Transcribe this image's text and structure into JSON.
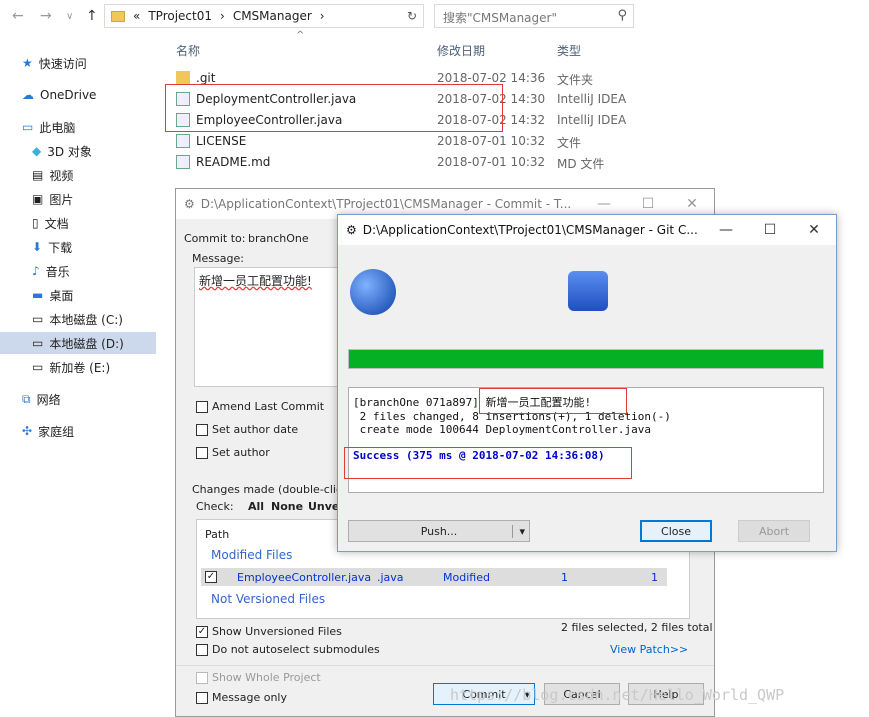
{
  "explorer": {
    "breadcrumb": [
      "«",
      "TProject01",
      "›",
      "CMSManager",
      "›"
    ],
    "search_placeholder": "搜索\"CMSManager\"",
    "columns": [
      "名称",
      "修改日期",
      "类型"
    ],
    "nav": [
      {
        "label": "快速访问",
        "icon": "star-icon"
      },
      {
        "label": "OneDrive",
        "icon": "cloud-icon"
      },
      {
        "label": "此电脑",
        "icon": "computer-icon"
      },
      {
        "label": "3D 对象",
        "icon": "cube-icon"
      },
      {
        "label": "视频",
        "icon": "video-icon"
      },
      {
        "label": "图片",
        "icon": "picture-icon"
      },
      {
        "label": "文档",
        "icon": "document-icon"
      },
      {
        "label": "下载",
        "icon": "download-icon"
      },
      {
        "label": "音乐",
        "icon": "music-icon"
      },
      {
        "label": "桌面",
        "icon": "desktop-icon"
      },
      {
        "label": "本地磁盘 (C:)",
        "icon": "drive-icon"
      },
      {
        "label": "本地磁盘 (D:)",
        "icon": "drive-icon"
      },
      {
        "label": "新加卷 (E:)",
        "icon": "drive-icon"
      },
      {
        "label": "网络",
        "icon": "network-icon"
      },
      {
        "label": "家庭组",
        "icon": "homegroup-icon"
      }
    ],
    "files": [
      {
        "name": ".git",
        "date": "2018-07-02 14:36",
        "type": "文件夹",
        "icon": "folder-icon"
      },
      {
        "name": "DeploymentController.java",
        "date": "2018-07-02 14:30",
        "type": "IntelliJ IDEA",
        "icon": "git-file-icon"
      },
      {
        "name": "EmployeeController.java",
        "date": "2018-07-02 14:32",
        "type": "IntelliJ IDEA",
        "icon": "git-file-icon"
      },
      {
        "name": "LICENSE",
        "date": "2018-07-01 10:32",
        "type": "文件",
        "icon": "git-file-icon"
      },
      {
        "name": "README.md",
        "date": "2018-07-01 10:32",
        "type": "MD 文件",
        "icon": "git-file-icon"
      }
    ]
  },
  "commit": {
    "title": "D:\\ApplicationContext\\TProject01\\CMSManager - Commit - T...",
    "commit_to_label": "Commit to:",
    "branch": "branchOne",
    "message_label": "Message:",
    "message": "新增一员工配置功能!",
    "amend": "Amend Last Commit",
    "set_author_date": "Set author date",
    "set_author": "Set author",
    "changes_label": "Changes made (double-click on",
    "check_label": "Check:",
    "check_all": "All",
    "check_none": "None",
    "check_unv": "Unve",
    "path_header": "Path",
    "modified_group": "Modified Files",
    "file_row": {
      "name": "EmployeeController.java",
      "ext": ".java",
      "status": "Modified",
      "added": "1",
      "removed": "1"
    },
    "not_versioned_group": "Not Versioned Files",
    "show_unversioned": "Show Unversioned Files",
    "no_autoselect": "Do not autoselect submodules",
    "files_selected": "2 files selected, 2 files total",
    "view_patch": "View Patch>>",
    "show_whole": "Show Whole Project",
    "message_only": "Message only",
    "commit_btn": "Commit",
    "cancel_btn": "Cancel",
    "help_btn": "Help"
  },
  "git": {
    "title": "D:\\ApplicationContext\\TProject01\\CMSManager - Git C...",
    "progress": 1.0,
    "log": [
      "[branchOne 071a897] 新增一员工配置功能!",
      " 2 files changed, 8 insertions(+), 1 deletion(-)",
      " create mode 100644 DeploymentController.java"
    ],
    "success": "Success (375 ms @ 2018-07-02 14:36:08)",
    "push_btn": "Push...",
    "close_btn": "Close",
    "abort_btn": "Abort"
  },
  "watermark": "https://blog.csdn.net/Hello_World_QWP",
  "colors": {
    "progress": "#06b025",
    "link": "#0066cc",
    "success": "#0000cc",
    "group": "#3366cc"
  }
}
